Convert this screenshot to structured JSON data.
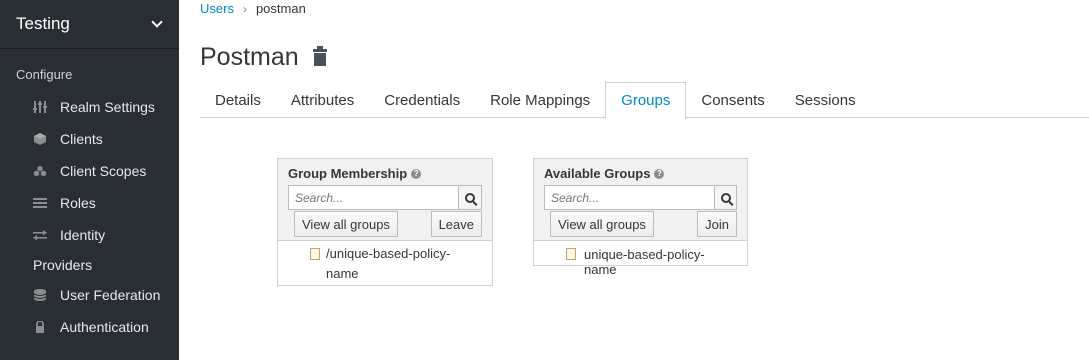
{
  "sidebar": {
    "realm_name": "Testing",
    "section_title": "Configure",
    "items": [
      {
        "label": "Realm Settings",
        "icon": "sliders-icon"
      },
      {
        "label": "Clients",
        "icon": "cube-icon"
      },
      {
        "label": "Client Scopes",
        "icon": "cubes-icon"
      },
      {
        "label": "Roles",
        "icon": "list-icon"
      },
      {
        "label": "Identity",
        "icon": "exchange-icon"
      },
      {
        "label": "Providers",
        "icon": ""
      },
      {
        "label": "User Federation",
        "icon": "database-icon"
      },
      {
        "label": "Authentication",
        "icon": "lock-icon"
      }
    ]
  },
  "breadcrumb": {
    "parent": "Users",
    "separator": "›",
    "current": "postman"
  },
  "page": {
    "title": "Postman"
  },
  "tabs": [
    {
      "label": "Details"
    },
    {
      "label": "Attributes"
    },
    {
      "label": "Credentials"
    },
    {
      "label": "Role Mappings"
    },
    {
      "label": "Groups",
      "active": true
    },
    {
      "label": "Consents"
    },
    {
      "label": "Sessions"
    }
  ],
  "group_membership": {
    "title": "Group Membership",
    "search_placeholder": "Search...",
    "view_all_label": "View all groups",
    "action_label": "Leave",
    "items": [
      "/unique-based-policy-name"
    ]
  },
  "available_groups": {
    "title": "Available Groups",
    "search_placeholder": "Search...",
    "view_all_label": "View all groups",
    "action_label": "Join",
    "items": [
      "unique-based-policy-name"
    ]
  },
  "colors": {
    "sidebar_bg": "#292e34",
    "accent": "#0088ce"
  }
}
